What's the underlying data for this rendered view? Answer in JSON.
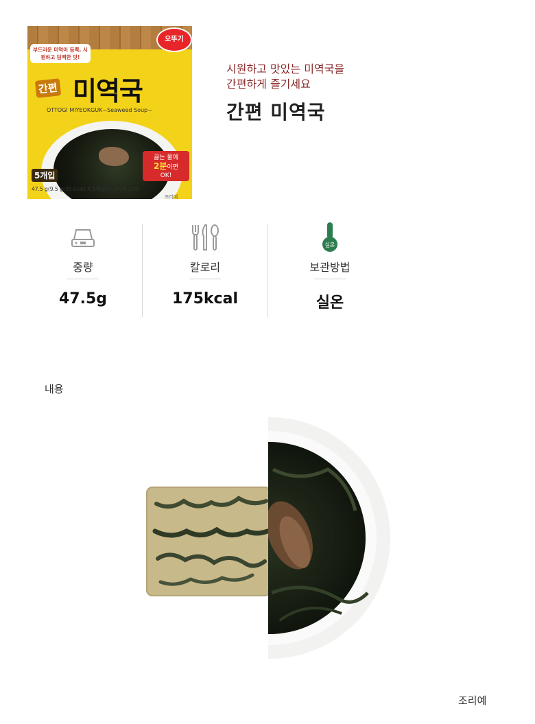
{
  "product_image": {
    "brand": "오뚜기",
    "tagline": "부드러운 미역이 듬뿍, 시원하고 담백한 맛!",
    "badge_prefix": "간편",
    "name": "미역국",
    "romanized": "OTTOGI MIYEOKGUK−Seaweed Soup−",
    "count": "5개입",
    "badge_line1": "끓는 물에",
    "badge_line2_highlight": "2분",
    "badge_line2_rest": "이면",
    "badge_line3": "OK!",
    "weight": "47.5 g(9.5 g(35 kcal) X 5개입) / 건미역 10%",
    "serving_note": "조리예"
  },
  "headline": {
    "subtitle": "시원하고 맛있는 미역국을\n간편하게 즐기세요",
    "title": "간편 미역국"
  },
  "info": [
    {
      "icon": "scale-icon",
      "label": "중량",
      "value": "47.5g"
    },
    {
      "icon": "utensils-icon",
      "label": "칼로리",
      "value": "175kcal"
    },
    {
      "icon": "thermometer-icon",
      "label": "보관방법",
      "value": "실온",
      "icon_text": "실온"
    }
  ],
  "contents": {
    "section_label": "내용",
    "caption": "조리예"
  },
  "colors": {
    "subtitle": "#8b2a2a",
    "icon_green": "#2e7d4f",
    "icon_gray": "#9a9a9a"
  }
}
